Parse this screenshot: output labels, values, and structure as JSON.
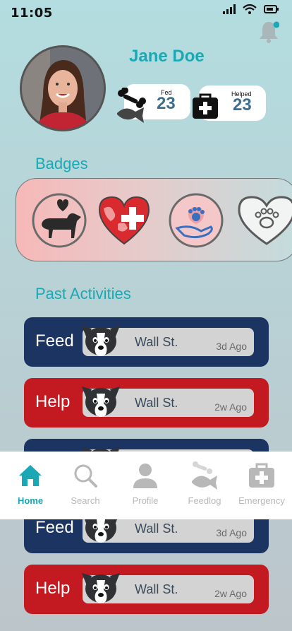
{
  "status_bar": {
    "time": "11:05"
  },
  "profile": {
    "name": "Jane Doe",
    "stats": [
      {
        "label": "Fed",
        "value": "23",
        "icon": "fish-bone-icon"
      },
      {
        "label": "Helped",
        "value": "23",
        "icon": "first-aid-kit-icon"
      }
    ]
  },
  "badges": {
    "title": "Badges",
    "items": [
      "dog-love-badge",
      "heart-cross-badge",
      "paw-hand-badge",
      "paw-heart-badge"
    ]
  },
  "activities": {
    "title": "Past Activities",
    "items": [
      {
        "type": "Feed",
        "location": "Wall St.",
        "time": "3d Ago"
      },
      {
        "type": "Help",
        "location": "Wall St.",
        "time": "2w Ago"
      },
      {
        "type": "Feed",
        "location": "Wall St.",
        "time": "3d Ago"
      },
      {
        "type": "Help",
        "location": "Wall St.",
        "time": "2w Ago"
      }
    ]
  },
  "nav": {
    "items": [
      {
        "label": "Home",
        "icon": "home-icon",
        "active": true
      },
      {
        "label": "Search",
        "icon": "search-icon"
      },
      {
        "label": "Profile",
        "icon": "profile-icon"
      },
      {
        "label": "Feedlog",
        "icon": "feedlog-icon"
      },
      {
        "label": "Emergency",
        "icon": "emergency-kit-icon"
      }
    ]
  },
  "colors": {
    "accent": "#1aa9b4",
    "feed": "#1b3461",
    "help": "#c21a20",
    "stat_value": "#3c6e8f"
  }
}
